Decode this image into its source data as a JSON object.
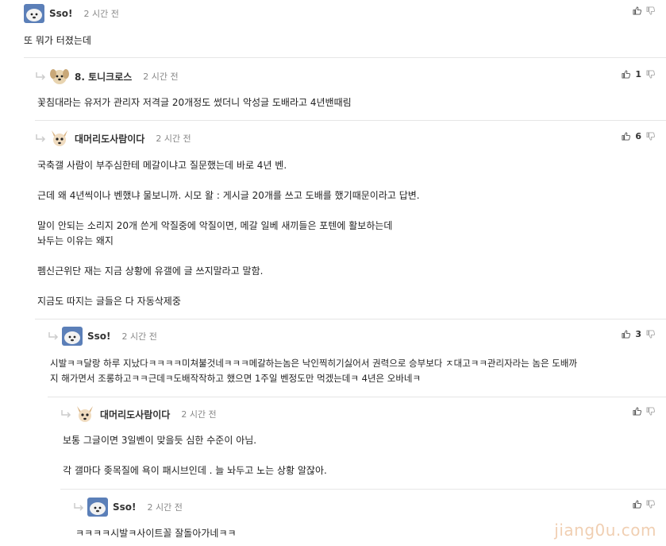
{
  "comments": [
    {
      "username": "Sso!",
      "time": "2 시간 전",
      "avatar": "dog-blue-avatar",
      "likes": "",
      "text": "또 뭐가 터졌는데"
    },
    {
      "username": "8. 토니크로스",
      "time": "2 시간 전",
      "avatar": "puppy-avatar",
      "likes": "1",
      "text": "꽃침대라는 유저가 관리자 저격글 20개정도 썼더니 악성글 도배라고 4년밴때림"
    },
    {
      "username": "대머리도사람이다",
      "time": "2 시간 전",
      "avatar": "chihuahua-avatar",
      "likes": "6",
      "text": "국축갤 사람이 부주심한테 메갈이냐고 질문했는데 바로 4년 벤.\n\n근데 왜 4년씩이나 벤했냐 물보니까. 시모 왈 : 게시글 20개를 쓰고 도배를 했기때문이라고 답변.\n\n말이 안되는 소리지 20개 쓴게 악질중에 악질이면, 메갈 일베 새끼들은 포텐에 활보하는데\n놔두는 이유는 왜지\n\n펨신근위단 재는 지금 상황에 유갤에 글 쓰지말라고 말함.\n\n지금도 따지는 글들은 다 자동삭제중"
    },
    {
      "username": "Sso!",
      "time": "2 시간 전",
      "avatar": "dog-blue-avatar",
      "likes": "3",
      "text": "시발ㅋㅋ달랑 하루 지났다ㅋㅋㅋㅋ미쳐불것네ㅋㅋㅋ메갈하는놈은 낙인찍히기싫어서 권력으로 승부보다 ㅈ대고ㅋㅋ관리자라는 놈은 도배까\n지 해가면서 조롱하고ㅋㅋ근데ㅋ도배작작하고 했으면 1주일 벤정도만 먹겠는데ㅋ 4년은 오바네ㅋ"
    },
    {
      "username": "대머리도사람이다",
      "time": "2 시간 전",
      "avatar": "chihuahua-avatar",
      "likes": "",
      "text": "보통 그글이면 3일벤이 맞을듯 심한 수준이 아님.\n\n각 갤마다 좆목질에 욕이 패시브인데 . 늘 놔두고 노는 상황 알잖아."
    },
    {
      "username": "Sso!",
      "time": "2 시간 전",
      "avatar": "dog-blue-avatar",
      "likes": "",
      "text": "ㅋㅋㅋㅋ시발ㅋ사이트꼴 잘돌아가네ㅋㅋ"
    }
  ],
  "watermark": "jiang0u.com"
}
